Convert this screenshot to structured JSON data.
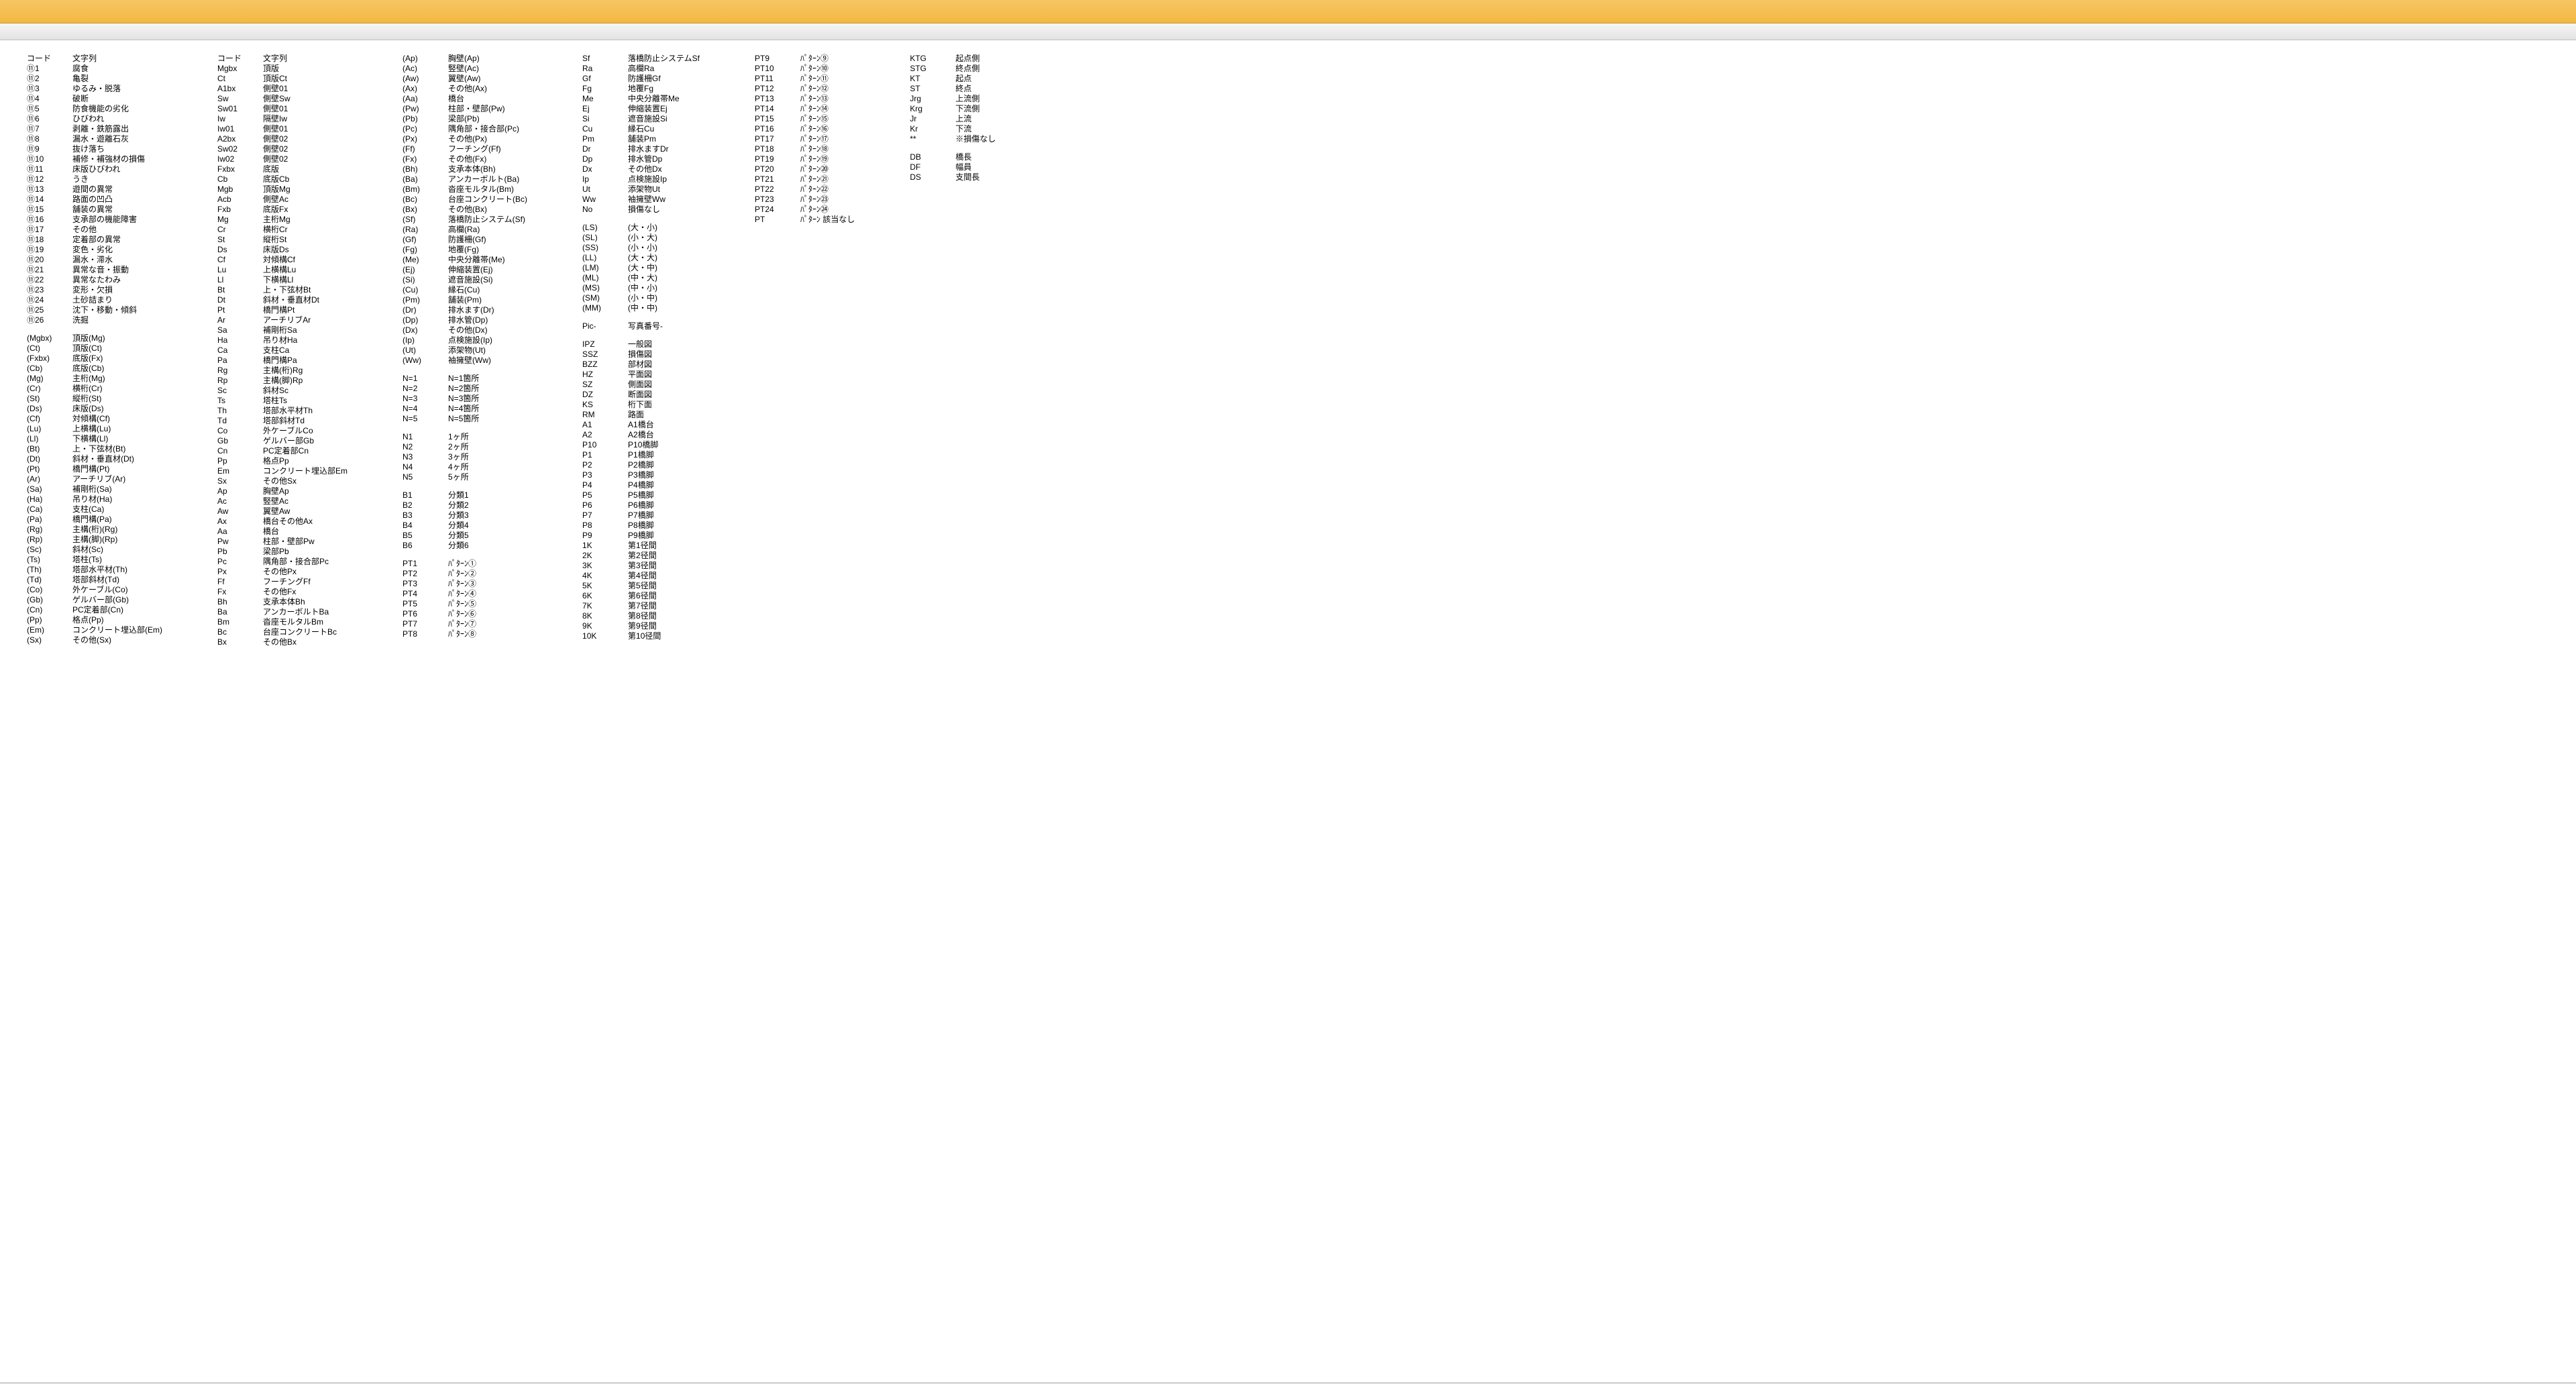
{
  "damage_codes": [
    [
      "コード",
      "文字列"
    ],
    [
      "⑪1",
      "腐食"
    ],
    [
      "⑪2",
      "亀裂"
    ],
    [
      "⑪3",
      "ゆるみ・脱落"
    ],
    [
      "⑪4",
      "破断"
    ],
    [
      "⑪5",
      "防食機能の劣化"
    ],
    [
      "⑪6",
      "ひびわれ"
    ],
    [
      "⑪7",
      "剥離・鉄筋露出"
    ],
    [
      "⑪8",
      "漏水・遊離石灰"
    ],
    [
      "⑪9",
      "抜け落ち"
    ],
    [
      "⑪10",
      "補修・補強材の損傷"
    ],
    [
      "⑪11",
      "床版ひびわれ"
    ],
    [
      "⑪12",
      "うき"
    ],
    [
      "⑪13",
      "遊間の異常"
    ],
    [
      "⑪14",
      "路面の凹凸"
    ],
    [
      "⑪15",
      "舗装の異常"
    ],
    [
      "⑪16",
      "支承部の機能障害"
    ],
    [
      "⑪17",
      "その他"
    ],
    [
      "⑪18",
      "定着部の異常"
    ],
    [
      "⑪19",
      "変色・劣化"
    ],
    [
      "⑪20",
      "漏水・滞水"
    ],
    [
      "⑪21",
      "異常な音・振動"
    ],
    [
      "⑪22",
      "異常なたわみ"
    ],
    [
      "⑪23",
      "変形・欠損"
    ],
    [
      "⑪24",
      "土砂詰まり"
    ],
    [
      "⑪25",
      "沈下・移動・傾斜"
    ],
    [
      "⑪26",
      "洗掘"
    ]
  ],
  "member_paren": [
    [
      "(Mgbx)",
      "頂版(Mg)"
    ],
    [
      "(Ct)",
      "頂版(Ct)"
    ],
    [
      "(Fxbx)",
      "底版(Fx)"
    ],
    [
      "(Cb)",
      "底版(Cb)"
    ],
    [
      "(Mg)",
      "主桁(Mg)"
    ],
    [
      "(Cr)",
      "横桁(Cr)"
    ],
    [
      "(St)",
      "縦桁(St)"
    ],
    [
      "(Ds)",
      "床版(Ds)"
    ],
    [
      "(Cf)",
      "対傾構(Cf)"
    ],
    [
      "(Lu)",
      "上横構(Lu)"
    ],
    [
      "(Ll)",
      "下横構(Ll)"
    ],
    [
      "(Bt)",
      "上・下弦材(Bt)"
    ],
    [
      "(Dt)",
      "斜材・垂直材(Dt)"
    ],
    [
      "(Pt)",
      "橋門構(Pt)"
    ],
    [
      "(Ar)",
      "アーチリブ(Ar)"
    ],
    [
      "(Sa)",
      "補剛桁(Sa)"
    ],
    [
      "(Ha)",
      "吊り材(Ha)"
    ],
    [
      "(Ca)",
      "支柱(Ca)"
    ],
    [
      "(Pa)",
      "橋門構(Pa)"
    ],
    [
      "(Rg)",
      "主構(桁)(Rg)"
    ],
    [
      "(Rp)",
      "主構(脚)(Rp)"
    ],
    [
      "(Sc)",
      "斜材(Sc)"
    ],
    [
      "(Ts)",
      "塔柱(Ts)"
    ],
    [
      "(Th)",
      "塔部水平材(Th)"
    ],
    [
      "(Td)",
      "塔部斜材(Td)"
    ],
    [
      "(Co)",
      "外ケーブル(Co)"
    ],
    [
      "(Gb)",
      "ゲルバー部(Gb)"
    ],
    [
      "(Cn)",
      "PC定着部(Cn)"
    ],
    [
      "(Pp)",
      "格点(Pp)"
    ],
    [
      "(Em)",
      "コンクリート埋込部(Em)"
    ],
    [
      "(Sx)",
      "その他(Sx)"
    ]
  ],
  "member_codes": [
    [
      "コード",
      "文字列"
    ],
    [
      "Mgbx",
      "頂版"
    ],
    [
      "Ct",
      "頂版Ct"
    ],
    [
      "A1bx",
      "側壁01"
    ],
    [
      "Sw",
      "側壁Sw"
    ],
    [
      "Sw01",
      "側壁01"
    ],
    [
      "Iw",
      "隔壁Iw"
    ],
    [
      "Iw01",
      "側壁01"
    ],
    [
      "A2bx",
      "側壁02"
    ],
    [
      "Sw02",
      "側壁02"
    ],
    [
      "Iw02",
      "側壁02"
    ],
    [
      "Fxbx",
      "底版"
    ],
    [
      "Cb",
      "底版Cb"
    ],
    [
      "Mgb",
      "頂版Mg"
    ],
    [
      "Acb",
      "側壁Ac"
    ],
    [
      "Fxb",
      "底版Fx"
    ],
    [
      "Mg",
      "主桁Mg"
    ],
    [
      "Cr",
      "横桁Cr"
    ],
    [
      "St",
      "縦桁St"
    ],
    [
      "Ds",
      "床版Ds"
    ],
    [
      "Cf",
      "対傾構Cf"
    ],
    [
      "Lu",
      "上横構Lu"
    ],
    [
      "Ll",
      "下横構Ll"
    ],
    [
      "Bt",
      "上・下弦材Bt"
    ],
    [
      "Dt",
      "斜材・垂直材Dt"
    ],
    [
      "Pt",
      "橋門構Pt"
    ],
    [
      "Ar",
      "アーチリブAr"
    ],
    [
      "Sa",
      "補剛桁Sa"
    ],
    [
      "Ha",
      "吊り材Ha"
    ],
    [
      "Ca",
      "支柱Ca"
    ],
    [
      "Pa",
      "橋門構Pa"
    ],
    [
      "Rg",
      "主構(桁)Rg"
    ],
    [
      "Rp",
      "主構(脚)Rp"
    ],
    [
      "Sc",
      "斜材Sc"
    ],
    [
      "Ts",
      "塔柱Ts"
    ],
    [
      "Th",
      "塔部水平材Th"
    ],
    [
      "Td",
      "塔部斜材Td"
    ],
    [
      "Co",
      "外ケーブルCo"
    ],
    [
      "Gb",
      "ゲルバー部Gb"
    ],
    [
      "Cn",
      "PC定着部Cn"
    ],
    [
      "Pp",
      "格点Pp"
    ],
    [
      "Em",
      "コンクリート埋込部Em"
    ],
    [
      "Sx",
      "その他Sx"
    ],
    [
      "Ap",
      "胸壁Ap"
    ],
    [
      "Ac",
      "竪壁Ac"
    ],
    [
      "Aw",
      "翼壁Aw"
    ],
    [
      "Ax",
      "橋台その他Ax"
    ],
    [
      "Aa",
      "橋台"
    ],
    [
      "Pw",
      "柱部・壁部Pw"
    ],
    [
      "Pb",
      "梁部Pb"
    ],
    [
      "Pc",
      "隅角部・接合部Pc"
    ],
    [
      "Px",
      "その他Px"
    ],
    [
      "Ff",
      "フーチングFf"
    ],
    [
      "Fx",
      "その他Fx"
    ],
    [
      "Bh",
      "支承本体Bh"
    ],
    [
      "Ba",
      "アンカーボルトBa"
    ],
    [
      "Bm",
      "沓座モルタルBm"
    ],
    [
      "Bc",
      "台座コンクリートBc"
    ],
    [
      "Bx",
      "その他Bx"
    ]
  ],
  "paren_members": [
    [
      "(Ap)",
      "胸壁(Ap)"
    ],
    [
      "(Ac)",
      "竪壁(Ac)"
    ],
    [
      "(Aw)",
      "翼壁(Aw)"
    ],
    [
      "(Ax)",
      "その他(Ax)"
    ],
    [
      "(Aa)",
      "橋台"
    ],
    [
      "(Pw)",
      "柱部・壁部(Pw)"
    ],
    [
      "(Pb)",
      "梁部(Pb)"
    ],
    [
      "(Pc)",
      "隅角部・接合部(Pc)"
    ],
    [
      "(Px)",
      "その他(Px)"
    ],
    [
      "(Ff)",
      "フーチング(Ff)"
    ],
    [
      "(Fx)",
      "その他(Fx)"
    ],
    [
      "(Bh)",
      "支承本体(Bh)"
    ],
    [
      "(Ba)",
      "アンカーボルト(Ba)"
    ],
    [
      "(Bm)",
      "沓座モルタル(Bm)"
    ],
    [
      "(Bc)",
      "台座コンクリート(Bc)"
    ],
    [
      "(Bx)",
      "その他(Bx)"
    ],
    [
      "(Sf)",
      "落橋防止システム(Sf)"
    ],
    [
      "(Ra)",
      "高欄(Ra)"
    ],
    [
      "(Gf)",
      "防護柵(Gf)"
    ],
    [
      "(Fg)",
      "地覆(Fg)"
    ],
    [
      "(Me)",
      "中央分離帯(Me)"
    ],
    [
      "(Ej)",
      "伸縮装置(Ej)"
    ],
    [
      "(Si)",
      "遮音施設(Si)"
    ],
    [
      "(Cu)",
      "縁石(Cu)"
    ],
    [
      "(Pm)",
      "舗装(Pm)"
    ],
    [
      "(Dr)",
      "排水ます(Dr)"
    ],
    [
      "(Dp)",
      "排水管(Dp)"
    ],
    [
      "(Dx)",
      "その他(Dx)"
    ],
    [
      "(Ip)",
      "点検施設(Ip)"
    ],
    [
      "(Ut)",
      "添架物(Ut)"
    ],
    [
      "(Ww)",
      "袖擁壁(Ww)"
    ]
  ],
  "n_eq": [
    [
      "N=1",
      "N=1箇所"
    ],
    [
      "N=2",
      "N=2箇所"
    ],
    [
      "N=3",
      "N=3箇所"
    ],
    [
      "N=4",
      "N=4箇所"
    ],
    [
      "N=5",
      "N=5箇所"
    ]
  ],
  "n_places": [
    [
      "N1",
      "1ヶ所"
    ],
    [
      "N2",
      "2ヶ所"
    ],
    [
      "N3",
      "3ヶ所"
    ],
    [
      "N4",
      "4ヶ所"
    ],
    [
      "N5",
      "5ヶ所"
    ]
  ],
  "b_class": [
    [
      "B1",
      "分類1"
    ],
    [
      "B2",
      "分類2"
    ],
    [
      "B3",
      "分類3"
    ],
    [
      "B4",
      "分類4"
    ],
    [
      "B5",
      "分類5"
    ],
    [
      "B6",
      "分類6"
    ]
  ],
  "pt_low": [
    [
      "PT1",
      "ﾊﾟﾀｰﾝ①"
    ],
    [
      "PT2",
      "ﾊﾟﾀｰﾝ②"
    ],
    [
      "PT3",
      "ﾊﾟﾀｰﾝ③"
    ],
    [
      "PT4",
      "ﾊﾟﾀｰﾝ④"
    ],
    [
      "PT5",
      "ﾊﾟﾀｰﾝ⑤"
    ],
    [
      "PT6",
      "ﾊﾟﾀｰﾝ⑥"
    ],
    [
      "PT7",
      "ﾊﾟﾀｰﾝ⑦"
    ],
    [
      "PT8",
      "ﾊﾟﾀｰﾝ⑧"
    ]
  ],
  "access": [
    [
      "Sf",
      "落橋防止システムSf"
    ],
    [
      "Ra",
      "高欄Ra"
    ],
    [
      "Gf",
      "防護柵Gf"
    ],
    [
      "Fg",
      "地覆Fg"
    ],
    [
      "Me",
      "中央分離帯Me"
    ],
    [
      "Ej",
      "伸縮装置Ej"
    ],
    [
      "Si",
      "遮音施設Si"
    ],
    [
      "Cu",
      "縁石Cu"
    ],
    [
      "Pm",
      "舗装Pm"
    ],
    [
      "Dr",
      "排水ますDr"
    ],
    [
      "Dp",
      "排水管Dp"
    ],
    [
      "Dx",
      "その他Dx"
    ],
    [
      "Ip",
      "点検施設Ip"
    ],
    [
      "Ut",
      "添架物Ut"
    ],
    [
      "Ww",
      "袖擁壁Ww"
    ],
    [
      "No",
      "損傷なし"
    ]
  ],
  "size": [
    [
      "(LS)",
      "(大・小)"
    ],
    [
      "(SL)",
      "(小・大)"
    ],
    [
      "(SS)",
      "(小・小)"
    ],
    [
      "(LL)",
      "(大・大)"
    ],
    [
      "(LM)",
      "(大・中)"
    ],
    [
      "(ML)",
      "(中・大)"
    ],
    [
      "(MS)",
      "(中・小)"
    ],
    [
      "(SM)",
      "(小・中)"
    ],
    [
      "(MM)",
      "(中・中)"
    ]
  ],
  "pic": [
    [
      "Pic-",
      "写真番号-"
    ]
  ],
  "drawings": [
    [
      "IPZ",
      "一般図"
    ],
    [
      "SSZ",
      "損傷図"
    ],
    [
      "BZZ",
      "部材図"
    ],
    [
      "HZ",
      "平面図"
    ],
    [
      "SZ",
      "側面図"
    ],
    [
      "DZ",
      "断面図"
    ],
    [
      "KS",
      "桁下面"
    ],
    [
      "RM",
      "路面"
    ],
    [
      "A1",
      "A1橋台"
    ],
    [
      "A2",
      "A2橋台"
    ],
    [
      "P10",
      "P10橋脚"
    ],
    [
      "P1",
      "P1橋脚"
    ],
    [
      "P2",
      "P2橋脚"
    ],
    [
      "P3",
      "P3橋脚"
    ],
    [
      "P4",
      "P4橋脚"
    ],
    [
      "P5",
      "P5橋脚"
    ],
    [
      "P6",
      "P6橋脚"
    ],
    [
      "P7",
      "P7橋脚"
    ],
    [
      "P8",
      "P8橋脚"
    ],
    [
      "P9",
      "P9橋脚"
    ],
    [
      "1K",
      "第1径間"
    ],
    [
      "2K",
      "第2径間"
    ],
    [
      "3K",
      "第3径間"
    ],
    [
      "4K",
      "第4径間"
    ],
    [
      "5K",
      "第5径間"
    ],
    [
      "6K",
      "第6径間"
    ],
    [
      "7K",
      "第7径間"
    ],
    [
      "8K",
      "第8径間"
    ],
    [
      "9K",
      "第9径間"
    ],
    [
      "10K",
      "第10径間"
    ]
  ],
  "pt_high": [
    [
      "PT9",
      "ﾊﾟﾀｰﾝ⑨"
    ],
    [
      "PT10",
      "ﾊﾟﾀｰﾝ⑩"
    ],
    [
      "PT11",
      "ﾊﾟﾀｰﾝ⑪"
    ],
    [
      "PT12",
      "ﾊﾟﾀｰﾝ⑫"
    ],
    [
      "PT13",
      "ﾊﾟﾀｰﾝ⑬"
    ],
    [
      "PT14",
      "ﾊﾟﾀｰﾝ⑭"
    ],
    [
      "PT15",
      "ﾊﾟﾀｰﾝ⑮"
    ],
    [
      "PT16",
      "ﾊﾟﾀｰﾝ⑯"
    ],
    [
      "PT17",
      "ﾊﾟﾀｰﾝ⑰"
    ],
    [
      "PT18",
      "ﾊﾟﾀｰﾝ⑱"
    ],
    [
      "PT19",
      "ﾊﾟﾀｰﾝ⑲"
    ],
    [
      "PT20",
      "ﾊﾟﾀｰﾝ⑳"
    ],
    [
      "PT21",
      "ﾊﾟﾀｰﾝ㉑"
    ],
    [
      "PT22",
      "ﾊﾟﾀｰﾝ㉒"
    ],
    [
      "PT23",
      "ﾊﾟﾀｰﾝ㉓"
    ],
    [
      "PT24",
      "ﾊﾟﾀｰﾝ㉔"
    ],
    [
      "PT",
      "ﾊﾟﾀｰﾝ 該当なし"
    ]
  ],
  "sides": [
    [
      "KTG",
      "起点側"
    ],
    [
      "STG",
      "終点側"
    ],
    [
      "KT",
      "起点"
    ],
    [
      "ST",
      "終点"
    ],
    [
      "Jrg",
      "上流側"
    ],
    [
      "Krg",
      "下流側"
    ],
    [
      "Jr",
      "上流"
    ],
    [
      "Kr",
      "下流"
    ],
    [
      "**",
      "※損傷なし"
    ]
  ],
  "dims": [
    [
      "DB",
      "橋長"
    ],
    [
      "DF",
      "幅員"
    ],
    [
      "DS",
      "支間長"
    ]
  ]
}
